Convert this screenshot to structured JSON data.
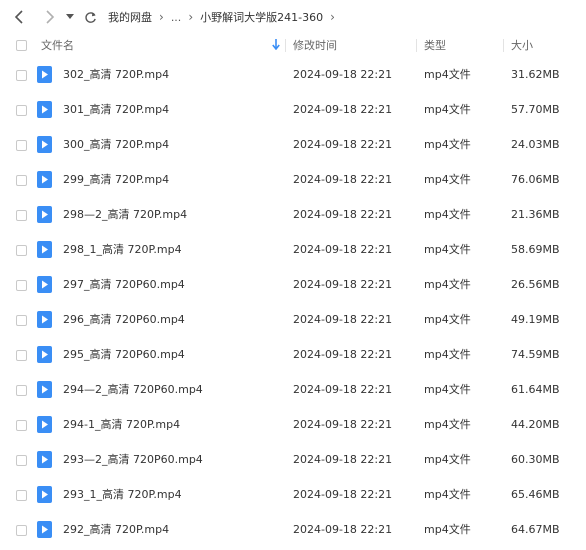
{
  "nav": {
    "back_icon": "chevron-left-icon",
    "forward_icon": "chevron-right-icon",
    "history_icon": "caret-down-icon",
    "refresh_icon": "refresh-icon",
    "breadcrumb": {
      "root": "我的网盘",
      "ellipsis": "...",
      "current": "小野解词大学版241-360"
    }
  },
  "table": {
    "columns": {
      "name": "文件名",
      "modified": "修改时间",
      "type": "类型",
      "size": "大小"
    },
    "sort_icon": "sort-down-arrow-icon",
    "file_icon": "video-play-icon",
    "rows": [
      {
        "name": "302_高清 720P.mp4",
        "modified": "2024-09-18 22:21",
        "type": "mp4文件",
        "size": "31.62MB"
      },
      {
        "name": "301_高清 720P.mp4",
        "modified": "2024-09-18 22:21",
        "type": "mp4文件",
        "size": "57.70MB"
      },
      {
        "name": "300_高清 720P.mp4",
        "modified": "2024-09-18 22:21",
        "type": "mp4文件",
        "size": "24.03MB"
      },
      {
        "name": "299_高清 720P.mp4",
        "modified": "2024-09-18 22:21",
        "type": "mp4文件",
        "size": "76.06MB"
      },
      {
        "name": "298—2_高清 720P.mp4",
        "modified": "2024-09-18 22:21",
        "type": "mp4文件",
        "size": "21.36MB"
      },
      {
        "name": "298_1_高清 720P.mp4",
        "modified": "2024-09-18 22:21",
        "type": "mp4文件",
        "size": "58.69MB"
      },
      {
        "name": "297_高清 720P60.mp4",
        "modified": "2024-09-18 22:21",
        "type": "mp4文件",
        "size": "26.56MB"
      },
      {
        "name": "296_高清 720P60.mp4",
        "modified": "2024-09-18 22:21",
        "type": "mp4文件",
        "size": "49.19MB"
      },
      {
        "name": "295_高清 720P60.mp4",
        "modified": "2024-09-18 22:21",
        "type": "mp4文件",
        "size": "74.59MB"
      },
      {
        "name": "294—2_高清 720P60.mp4",
        "modified": "2024-09-18 22:21",
        "type": "mp4文件",
        "size": "61.64MB"
      },
      {
        "name": "294-1_高清 720P.mp4",
        "modified": "2024-09-18 22:21",
        "type": "mp4文件",
        "size": "44.20MB"
      },
      {
        "name": "293—2_高清 720P60.mp4",
        "modified": "2024-09-18 22:21",
        "type": "mp4文件",
        "size": "60.30MB"
      },
      {
        "name": "293_1_高清 720P.mp4",
        "modified": "2024-09-18 22:21",
        "type": "mp4文件",
        "size": "65.46MB"
      },
      {
        "name": "292_高清 720P.mp4",
        "modified": "2024-09-18 22:21",
        "type": "mp4文件",
        "size": "64.67MB"
      }
    ]
  },
  "colors": {
    "accent": "#3a8ef5",
    "text": "#333333",
    "header_text": "#666666"
  }
}
